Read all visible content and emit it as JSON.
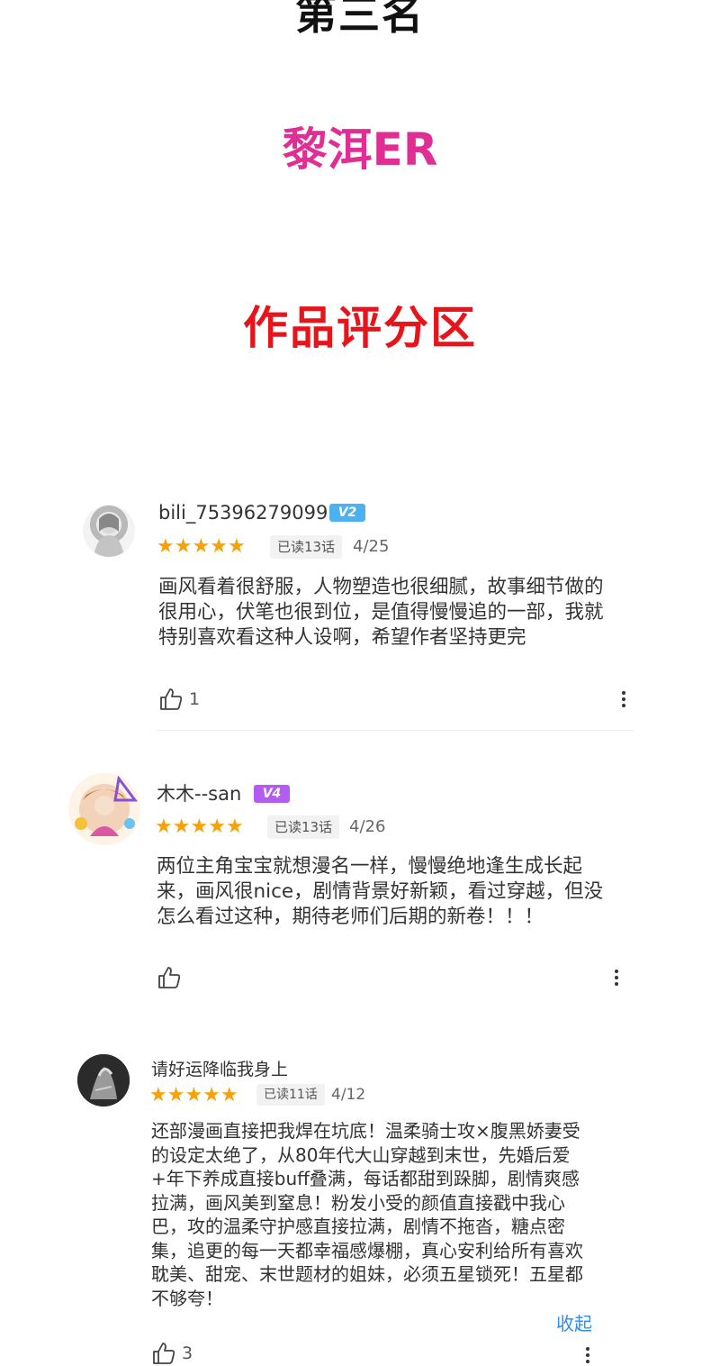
{
  "header": {
    "rank_title": "第三名",
    "author_name": "黎洱ER",
    "section_title": "作品评分区"
  },
  "colors": {
    "author": "#e02e94",
    "section": "#e8141c",
    "star": "#f5a20a",
    "v2_badge": "#4cb1f0",
    "v4_badge": "#b45cf0",
    "link": "#2a8ff0"
  },
  "reviews": [
    {
      "username": "bili_75396279099",
      "level_badge": "V2",
      "rating_stars": 5,
      "read_tag": "已读13话",
      "date": "4/25",
      "text": "画风看着很舒服，人物塑造也很细腻，故事细节做的很用心，伏笔也很到位，是值得慢慢追的一部，我就特别喜欢看这种人设啊，希望作者坚持更完",
      "likes": "1"
    },
    {
      "username": "木木--san",
      "level_badge": "V4",
      "rating_stars": 5,
      "read_tag": "已读13话",
      "date": "4/26",
      "text": "两位主角宝宝就想漫名一样，慢慢绝地逢生成长起来，画风很nice，剧情背景好新颖，看过穿越，但没怎么看过这种，期待老师们后期的新卷！！！",
      "likes": ""
    },
    {
      "username": "请好运降临我身上",
      "rating_stars": 5,
      "read_tag": "已读11话",
      "date": "4/12",
      "text": "还部漫画直接把我焊在坑底！温柔骑士攻×腹黑娇妻受的设定太绝了，从80年代大山穿越到末世，先婚后爱+年下养成直接buff叠满，每话都甜到跺脚，剧情爽感拉满，画风美到窒息！粉发小受的颜值直接戳中我心巴，攻的温柔守护感直接拉满，剧情不拖沓，糖点密集，追更的每一天都幸福感爆棚，真心安利给所有喜欢耽美、甜宠、末世题材的姐妹，必须五星锁死！五星都不够夸！",
      "collapse_label": "收起",
      "likes": "3"
    }
  ]
}
